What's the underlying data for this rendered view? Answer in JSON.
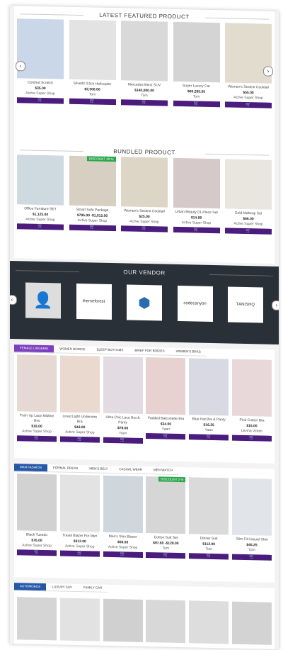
{
  "featured": {
    "title": "LATEST FEATURED PRODUCT",
    "products": [
      {
        "name": "Colored Scratch",
        "price": "$35.00",
        "vendor": "Active Super Shop",
        "thumb": "#c9d7e8"
      },
      {
        "name": "Silverlit 3.5ch Helicopter",
        "price": "$2,500.00",
        "vendor": "Tom",
        "thumb": "#e3e3e3"
      },
      {
        "name": "Mercedes Benz SUV",
        "price": "$140,000.00",
        "vendor": "Tom",
        "thumb": "#d9d9d9"
      },
      {
        "name": "Super Luxury Car",
        "price": "$60,285.00",
        "vendor": "Tom",
        "thumb": "#d4d4d4"
      },
      {
        "name": "Women's Sexiest Cocktail",
        "price": "$55.00",
        "vendor": "Active Super Shop",
        "thumb": "#e2dccf"
      }
    ]
  },
  "bundled": {
    "title": "BUNDLED PRODUCT",
    "badge": "DISCOUNT 20 %",
    "products": [
      {
        "name": "Office Furniture SET",
        "price": "$1,125.00",
        "vendor": "Active Super Shop",
        "thumb": "#cfd9e0"
      },
      {
        "name": "Smart Sofa Package",
        "price": "$795.00 -$1,012.00",
        "vendor": "Active Super Shop",
        "thumb": "#d8cfc3"
      },
      {
        "name": "Women's Sexiest Cocktail",
        "price": "$25.00",
        "vendor": "Active Super Shop",
        "thumb": "#ddd6c6"
      },
      {
        "name": "Urban Beauty 01-Piece Set",
        "price": "$14.99",
        "vendor": "Active Super Shop",
        "thumb": "#d6c9c9"
      },
      {
        "name": "Gold Makeup Set",
        "price": "$66.00",
        "vendor": "Active Super Shop",
        "thumb": "#e9e6e0"
      }
    ]
  },
  "vendors": {
    "title": "OUR VENDOR",
    "items": [
      "",
      "themeforest",
      "",
      "codecanyon",
      "TANISHQ"
    ]
  },
  "lingerie": {
    "tabs": [
      "FEMALE LINGERIE",
      "WOMEN BODICE",
      "SLEEP BOTTOMS",
      "BRIEF FOR BODIES",
      "WOMEN'S BRAS"
    ],
    "products": [
      {
        "name": "Push Up Lace Midline Bra",
        "price": "$18.00",
        "vendor": "Active Super Shop",
        "thumb": "#e6d8d2"
      },
      {
        "name": "Lined Light Underwire Bra",
        "price": "$43.00",
        "vendor": "Active Super Shop",
        "thumb": "#ead9cf"
      },
      {
        "name": "Ultra Chic Lace Bra & Panty",
        "price": "$78.00",
        "vendor": "Yaan",
        "thumb": "#e3dbe2"
      },
      {
        "name": "Padded Balconette Bra",
        "price": "$34.00",
        "vendor": "Yaan",
        "thumb": "#e8d1d1"
      },
      {
        "name": "Blue Hot Bra & Panty",
        "price": "$16.25",
        "vendor": "Yaan",
        "thumb": "#d9d9e4"
      },
      {
        "name": "Pink Cotton Bra",
        "price": "$15.00",
        "vendor": "Levina Vintee",
        "thumb": "#e9d8da"
      }
    ]
  },
  "mens": {
    "tabs": [
      "MAN FASHION",
      "FORMAL DRESS",
      "MEN'S BELT",
      "CASUAL WEAR",
      "MEN WATCH"
    ],
    "badge": "DISCOUNT 2 %",
    "products": [
      {
        "name": "Black Tuxedo",
        "price": "$76.00",
        "vendor": "Active Super Shop",
        "thumb": "#d2d2d2"
      },
      {
        "name": "Travel Blazer For Men",
        "price": "$312.00",
        "vendor": "Active Super Shop",
        "thumb": "#e3e3e3"
      },
      {
        "name": "Men's Slim Blazer",
        "price": "$56.50",
        "vendor": "Active Super Shop",
        "thumb": "#cfd6dc"
      },
      {
        "name": "Cotton Suit Set",
        "price": "$97.60 -$128.00",
        "vendor": "Tom",
        "thumb": "#d6d6d6"
      },
      {
        "name": "Dinner Suit",
        "price": "$112.00",
        "vendor": "Tom",
        "thumb": "#dadada"
      },
      {
        "name": "Slim Fit Casual Shirt",
        "price": "$45.25",
        "vendor": "Tom",
        "thumb": "#e1e5e9"
      }
    ]
  },
  "auto": {
    "tabs": [
      "AUTOMOBILE",
      "LUXURY SUV",
      "FAMILY CAR"
    ],
    "thumbs": [
      "#d5d5d5",
      "#e2e2e2",
      "#d0d0d0",
      "#d8d8d8",
      "#dddddd",
      "#d3d3d3"
    ]
  },
  "icons": {
    "cart": "cart-icon",
    "arrow_left": "‹",
    "arrow_right": "›"
  }
}
